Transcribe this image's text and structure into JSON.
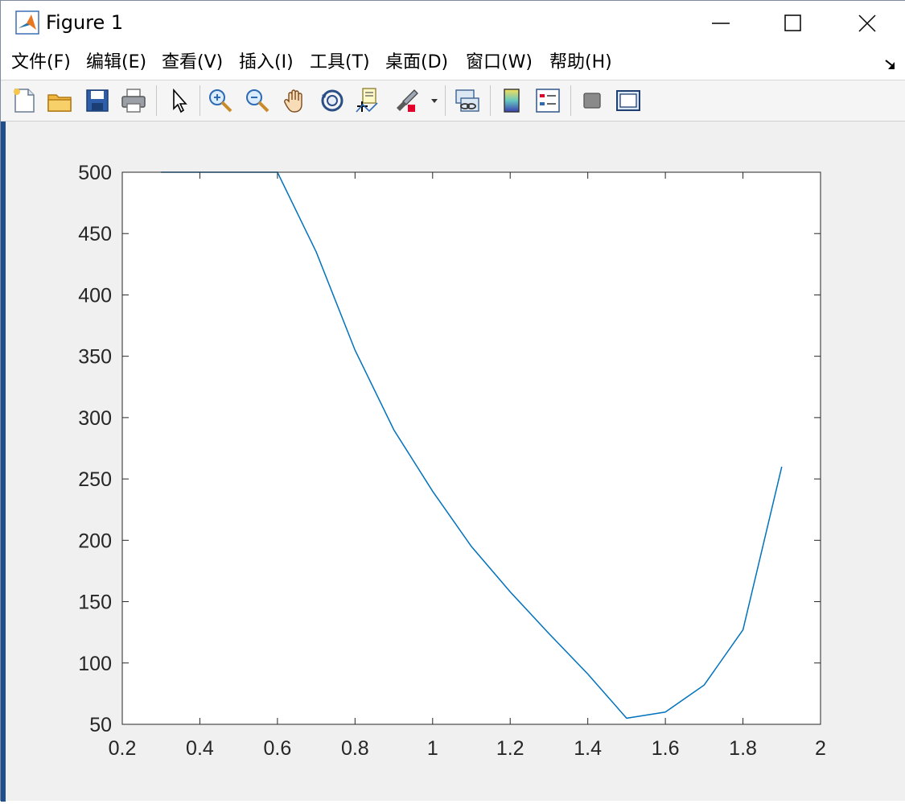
{
  "window": {
    "title": "Figure 1",
    "minimize_icon": "minimize-icon",
    "maximize_icon": "maximize-icon",
    "close_icon": "close-icon"
  },
  "menu": {
    "items": [
      "文件(F)",
      "编辑(E)",
      "查看(V)",
      "插入(I)",
      "工具(T)",
      "桌面(D)",
      "窗口(W)",
      "帮助(H)"
    ]
  },
  "toolbar": {
    "icons": [
      "new-figure-icon",
      "open-file-icon",
      "save-icon",
      "print-icon",
      "pointer-icon",
      "zoom-in-icon",
      "zoom-out-icon",
      "pan-hand-icon",
      "rotate-3d-icon",
      "data-cursor-icon",
      "brush-icon",
      "brush-dropdown-icon",
      "link-plot-icon",
      "colorbar-icon",
      "legend-icon",
      "hide-plot-tools-icon",
      "show-plot-tools-icon"
    ]
  },
  "colors": {
    "line": "#0072bd",
    "axes_bg": "#ffffff",
    "figure_bg": "#f0f0f0"
  },
  "chart_data": {
    "type": "line",
    "title": "",
    "xlabel": "",
    "ylabel": "",
    "xlim": [
      0.2,
      2
    ],
    "ylim": [
      50,
      500
    ],
    "xticks": [
      0.2,
      0.4,
      0.6,
      0.8,
      1,
      1.2,
      1.4,
      1.6,
      1.8,
      2
    ],
    "xtick_labels": [
      "0.2",
      "0.4",
      "0.6",
      "0.8",
      "1",
      "1.2",
      "1.4",
      "1.6",
      "1.8",
      "2"
    ],
    "yticks": [
      50,
      100,
      150,
      200,
      250,
      300,
      350,
      400,
      450,
      500
    ],
    "ytick_labels": [
      "50",
      "100",
      "150",
      "200",
      "250",
      "300",
      "350",
      "400",
      "450",
      "500"
    ],
    "grid": false,
    "series": [
      {
        "x": [
          0.3,
          0.4,
          0.5,
          0.6,
          0.7,
          0.8,
          0.9,
          1.0,
          1.1,
          1.2,
          1.3,
          1.4,
          1.5,
          1.6,
          1.7,
          1.8,
          1.9
        ],
        "y": [
          500,
          500,
          500,
          500,
          435,
          355,
          290,
          240,
          195,
          158,
          124,
          91,
          55,
          60,
          82,
          127,
          260
        ]
      }
    ]
  }
}
